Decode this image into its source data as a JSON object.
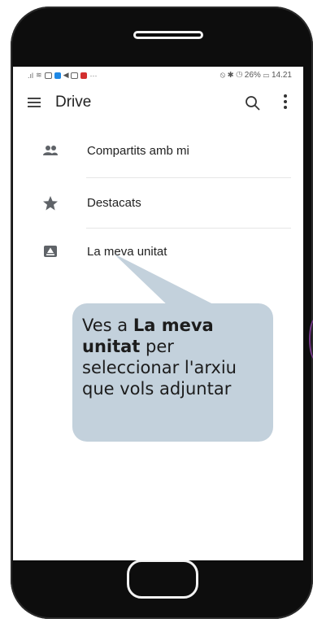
{
  "statusbar": {
    "right": "⦸ ✱ ◷ 26% ▭ 14.21"
  },
  "appbar": {
    "title": "Drive",
    "search_icon": "search-icon",
    "more_icon": "more-vert-icon",
    "menu_icon": "menu-icon"
  },
  "nav": {
    "items": [
      {
        "label": "Compartits amb mi",
        "icon": "people-icon"
      },
      {
        "label": "Destacats",
        "icon": "star-icon"
      },
      {
        "label": "La meva unitat",
        "icon": "drive-icon"
      }
    ]
  },
  "callout": {
    "prefix": "Ves a ",
    "bold": "La meva unitat",
    "suffix": " per seleccionar l'arxiu que vols adjuntar"
  },
  "colors": {
    "callout_bg": "#c3d1dc",
    "phone_body": "#0d0d0d"
  }
}
